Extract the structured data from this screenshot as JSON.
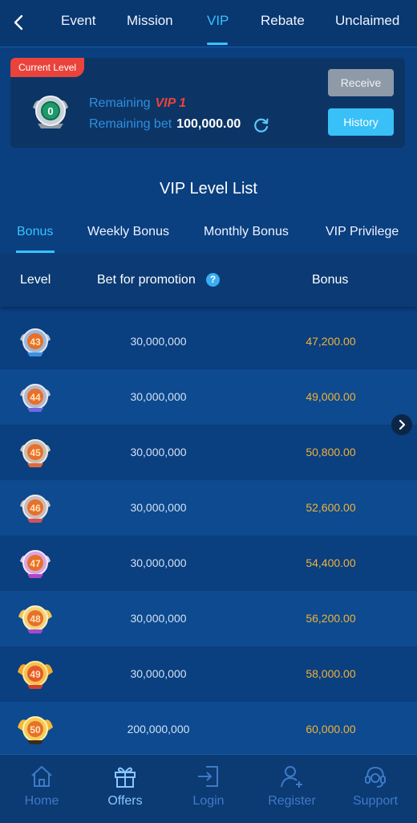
{
  "topnav": {
    "tabs": [
      {
        "label": "Event"
      },
      {
        "label": "Mission"
      },
      {
        "label": "VIP",
        "active": true
      },
      {
        "label": "Rebate"
      },
      {
        "label": "Unclaimed"
      }
    ]
  },
  "current_level": {
    "tag": "Current Level",
    "badge_level": "0",
    "remaining_label": "Remaining",
    "remaining_vip": "VIP 1",
    "remaining_bet_label": "Remaining bet",
    "remaining_bet_value": "100,000.00",
    "receive_label": "Receive",
    "history_label": "History"
  },
  "list": {
    "title": "VIP Level List",
    "subtabs": [
      "Bonus",
      "Weekly Bonus",
      "Monthly Bonus",
      "VIP Privilege"
    ],
    "columns": {
      "level": "Level",
      "bet": "Bet for promotion",
      "bonus": "Bonus"
    },
    "help_glyph": "?",
    "rows": [
      {
        "level": "43",
        "bet": "30,000,000",
        "bonus": "47,200.00"
      },
      {
        "level": "44",
        "bet": "30,000,000",
        "bonus": "49,000.00"
      },
      {
        "level": "45",
        "bet": "30,000,000",
        "bonus": "50,800.00"
      },
      {
        "level": "46",
        "bet": "30,000,000",
        "bonus": "52,600.00"
      },
      {
        "level": "47",
        "bet": "30,000,000",
        "bonus": "54,400.00"
      },
      {
        "level": "48",
        "bet": "30,000,000",
        "bonus": "56,200.00"
      },
      {
        "level": "49",
        "bet": "30,000,000",
        "bonus": "58,000.00"
      },
      {
        "level": "50",
        "bet": "200,000,000",
        "bonus": "60,000.00"
      }
    ]
  },
  "bottomnav": {
    "items": [
      {
        "label": "Home",
        "icon": "home-icon"
      },
      {
        "label": "Offers",
        "icon": "gift-icon",
        "active": true
      },
      {
        "label": "Login",
        "icon": "login-icon"
      },
      {
        "label": "Register",
        "icon": "register-icon"
      },
      {
        "label": "Support",
        "icon": "support-icon"
      }
    ]
  },
  "colors": {
    "accent": "#38c3ff",
    "bonus": "#f0b23a",
    "tag_red": "#e9433b",
    "background": "#0a3f80"
  }
}
